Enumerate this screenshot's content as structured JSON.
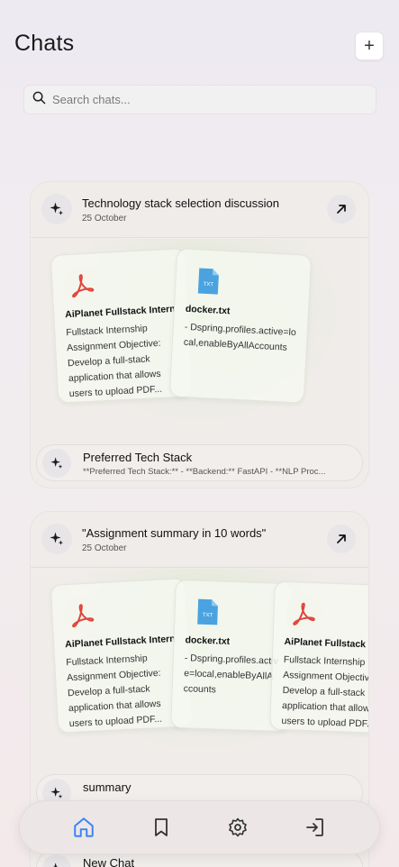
{
  "header": {
    "title": "Chats",
    "add_label": "+"
  },
  "search": {
    "placeholder": "Search chats..."
  },
  "chat_groups": [
    {
      "title": "Technology stack selection discussion",
      "date": "25 October",
      "documents": [
        {
          "name": "AiPlanet Fullstack Intern",
          "snippet": "Fullstack Internship Assignment Objective: Develop a full-stack application that allows users to upload PDF...",
          "icon": "pdf-icon"
        },
        {
          "name": "docker.txt",
          "snippet": "- Dspring.profiles.active=local,enableByAllAccounts",
          "icon": "txt-file-icon"
        }
      ],
      "chat": {
        "title": "Preferred Tech Stack",
        "preview": "**Preferred Tech Stack:** - **Backend:** FastAPI - **NLP Proc..."
      }
    },
    {
      "title": "\"Assignment summary in 10 words\"",
      "date": "25 October",
      "documents": [
        {
          "name": "AiPlanet Fullstack Intern",
          "snippet": "Fullstack Internship Assignment Objective: Develop a full-stack application that allows users to upload PDF...",
          "icon": "pdf-icon"
        },
        {
          "name": "docker.txt",
          "snippet": "- Dspring.profiles.active=local,enableByAllAccounts",
          "icon": "txt-file-icon"
        },
        {
          "name": "AiPlanet Fullstack",
          "snippet": "Fullstack Internship Assignment Objective: Develop a full-stack application that allows users to upload PDF...",
          "icon": "pdf-icon"
        }
      ],
      "chat": {
        "title": "summary",
        "preview": ""
      }
    }
  ],
  "next_chat": {
    "title": "New Chat"
  },
  "nav": [
    "home-icon",
    "bookmark-icon",
    "gear-icon",
    "logout-icon"
  ],
  "colors": {
    "accent": "#3b82f6",
    "pdf_red": "#e0453b",
    "txt_blue": "#4aa3e0"
  }
}
